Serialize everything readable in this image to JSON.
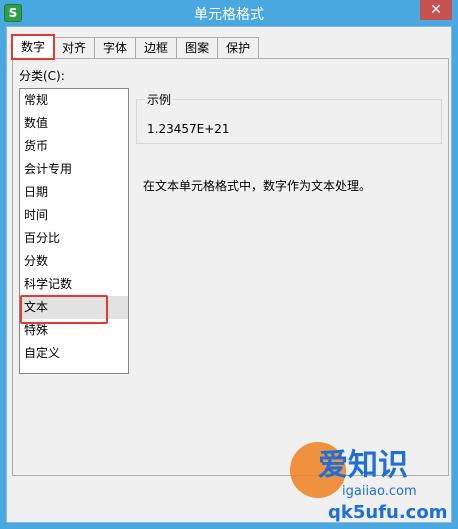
{
  "window": {
    "title": "单元格格式",
    "app_icon_letter": "S",
    "close_symbol": "✕"
  },
  "tabs": [
    {
      "label": "数字",
      "active": true
    },
    {
      "label": "对齐",
      "active": false
    },
    {
      "label": "字体",
      "active": false
    },
    {
      "label": "边框",
      "active": false
    },
    {
      "label": "图案",
      "active": false
    },
    {
      "label": "保护",
      "active": false
    }
  ],
  "category": {
    "label": "分类(C):",
    "items": [
      "常规",
      "数值",
      "货币",
      "会计专用",
      "日期",
      "时间",
      "百分比",
      "分数",
      "科学记数",
      "文本",
      "特殊",
      "自定义"
    ],
    "selected": "文本"
  },
  "sample": {
    "legend": "示例",
    "value": "1.23457E+21"
  },
  "description": "在文本单元格格式中，数字作为文本处理。",
  "watermark": {
    "line1": "爱知识",
    "line2": "igaiiao.com",
    "line3": "qk5ufu.com"
  },
  "colors": {
    "titlebar": "#4aa8e0",
    "close_button": "#c75050",
    "highlight_outline": "#e53935",
    "watermark_blue": "#1e6fd8",
    "watermark_orange": "#ee801e"
  }
}
